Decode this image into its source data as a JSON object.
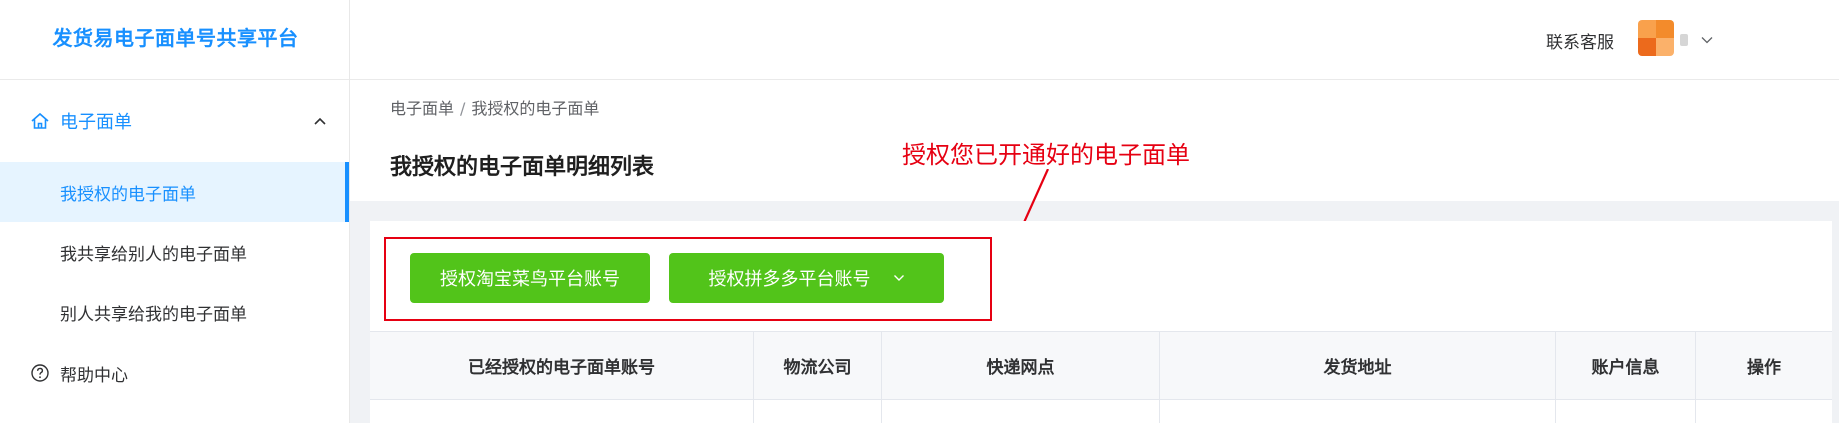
{
  "app": {
    "title": "发货易电子面单号共享平台"
  },
  "header": {
    "contact_label": "联系客服"
  },
  "sidebar": {
    "group_label": "电子面单",
    "items": [
      {
        "label": "我授权的电子面单"
      },
      {
        "label": "我共享给别人的电子面单"
      },
      {
        "label": "别人共享给我的电子面单"
      }
    ],
    "help_label": "帮助中心"
  },
  "breadcrumb": {
    "parent": "电子面单",
    "separator": "/",
    "current": "我授权的电子面单"
  },
  "page": {
    "title": "我授权的电子面单明细列表"
  },
  "annotation": {
    "text": "授权您已开通好的电子面单",
    "color": "#e60012"
  },
  "actions": {
    "taobao_label": "授权淘宝菜鸟平台账号",
    "pdd_label": "授权拼多多平台账号",
    "button_color": "#52c41a"
  },
  "table": {
    "columns": [
      "已经授权的电子面单账号",
      "物流公司",
      "快递网点",
      "发货地址",
      "账户信息",
      "操作"
    ]
  },
  "colors": {
    "accent": "#1890ff",
    "success": "#52c41a",
    "annotation": "#e60012"
  },
  "icons": [
    "home-icon",
    "chevron-up-icon",
    "help-circle-icon",
    "chevron-down-icon"
  ]
}
